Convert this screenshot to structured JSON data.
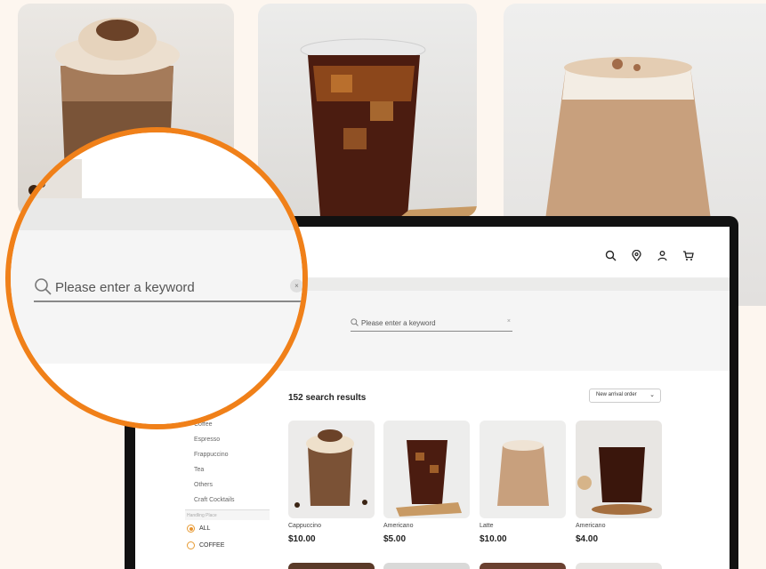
{
  "header": {
    "icons": [
      "search-icon",
      "location-icon",
      "user-icon",
      "cart-icon"
    ]
  },
  "search": {
    "placeholder": "Please enter a keyword",
    "clear_symbol": "×"
  },
  "results": {
    "title": "152 search results",
    "sort_label": "New arrival order",
    "sort_symbol": "⌄"
  },
  "sidebar": {
    "items": [
      "Coffee",
      "Espresso",
      "Frappuccino",
      "Tea",
      "Others",
      "Craft Cocktails"
    ],
    "section_label": "Handling Place",
    "options": [
      {
        "label": "ALL",
        "selected": true
      },
      {
        "label": "COFFEE",
        "selected": false
      }
    ]
  },
  "products": [
    {
      "name": "Cappuccino",
      "price": "$10.00"
    },
    {
      "name": "Americano",
      "price": "$5.00"
    },
    {
      "name": "Latte",
      "price": "$10.00"
    },
    {
      "name": "Americano",
      "price": "$4.00"
    }
  ],
  "colors": {
    "accent": "#f08019",
    "radio": "#e8922d"
  }
}
